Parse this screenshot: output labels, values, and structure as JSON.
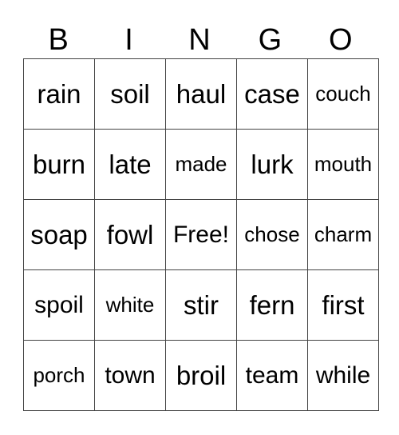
{
  "header": [
    "B",
    "I",
    "N",
    "G",
    "O"
  ],
  "rows": [
    [
      "rain",
      "soil",
      "haul",
      "case",
      "couch"
    ],
    [
      "burn",
      "late",
      "made",
      "lurk",
      "mouth"
    ],
    [
      "soap",
      "fowl",
      "Free!",
      "chose",
      "charm"
    ],
    [
      "spoil",
      "white",
      "stir",
      "fern",
      "first"
    ],
    [
      "porch",
      "town",
      "broil",
      "team",
      "while"
    ]
  ]
}
